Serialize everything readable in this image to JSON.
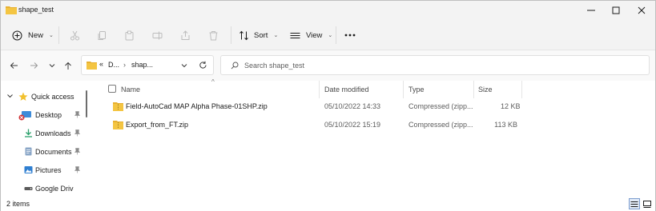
{
  "window": {
    "title": "shape_test",
    "controls": [
      "minimize",
      "maximize",
      "close"
    ]
  },
  "toolbar": {
    "new_label": "New",
    "sort_label": "Sort",
    "view_label": "View",
    "disabled_actions": [
      "cut-icon",
      "copy-icon",
      "paste-icon",
      "rename-icon",
      "share-icon",
      "delete-icon"
    ],
    "more_icon": "ellipsis-icon"
  },
  "navigation": {
    "address_prefix": "«",
    "address_segments": [
      "D...",
      "shap..."
    ],
    "search_placeholder": "Search shape_test"
  },
  "sidebar": {
    "items": [
      {
        "label": "Quick access",
        "icon": "star-icon",
        "pinned": false
      },
      {
        "label": "Desktop",
        "icon": "desktop-icon",
        "pinned": true
      },
      {
        "label": "Downloads",
        "icon": "download-icon",
        "pinned": true
      },
      {
        "label": "Documents",
        "icon": "document-icon",
        "pinned": true
      },
      {
        "label": "Pictures",
        "icon": "picture-icon",
        "pinned": true
      },
      {
        "label": "Google Drive",
        "icon": "drive-icon",
        "pinned": false
      }
    ]
  },
  "file_list": {
    "columns": [
      "Name",
      "Date modified",
      "Type",
      "Size"
    ],
    "rows": [
      {
        "name": "Field-AutoCad MAP Alpha Phase-01SHP.zip",
        "date": "05/10/2022 14:33",
        "type": "Compressed (zipp...",
        "size": "12 KB"
      },
      {
        "name": "Export_from_FT.zip",
        "date": "05/10/2022 15:19",
        "type": "Compressed (zipp...",
        "size": "113 KB"
      }
    ]
  },
  "status": {
    "item_count": "2 items"
  },
  "colors": {
    "folder": "#f4c542",
    "accent": "#2f6bd1",
    "chrome": "#f3f3f3"
  }
}
